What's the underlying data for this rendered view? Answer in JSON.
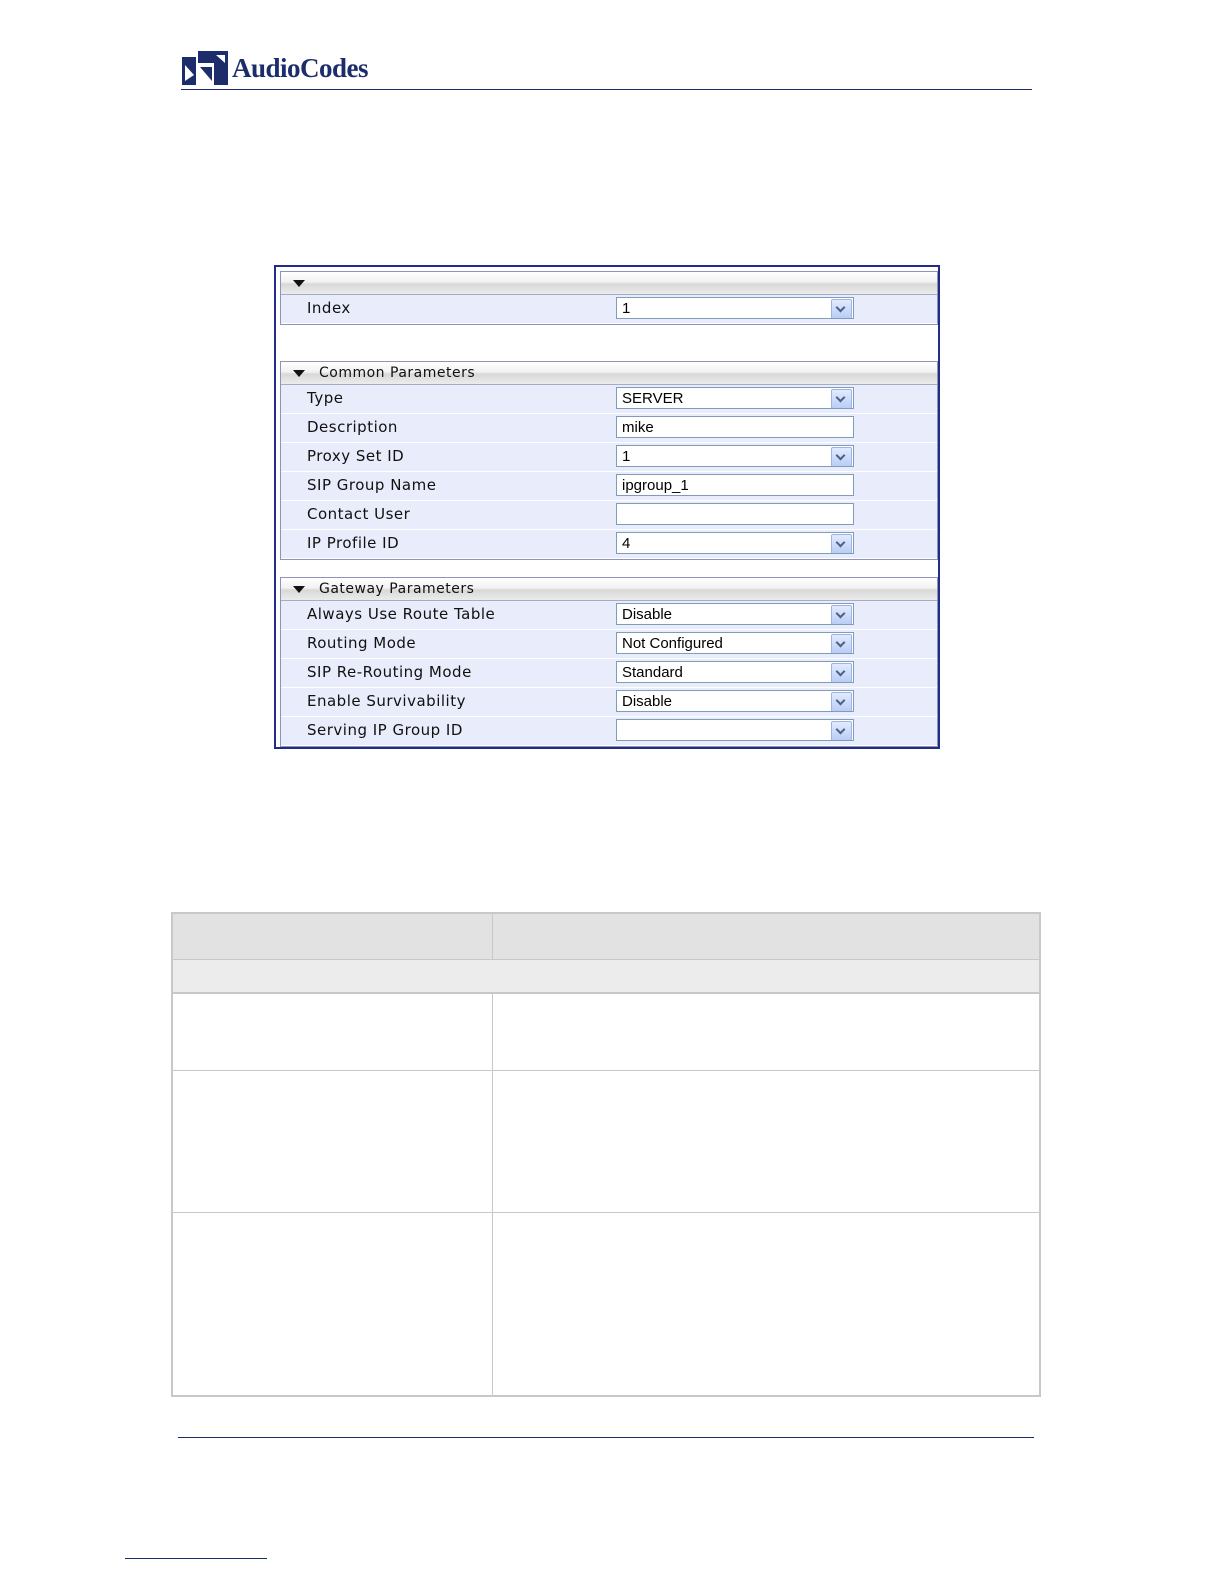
{
  "header": {
    "brand": "AudioCodes"
  },
  "panel": {
    "index_group": {
      "title": "",
      "rows": [
        {
          "label": "Index",
          "value": "1",
          "control": "select"
        }
      ]
    },
    "common_group": {
      "title": "Common Parameters",
      "rows": [
        {
          "label": "Type",
          "value": "SERVER",
          "control": "select"
        },
        {
          "label": "Description",
          "value": "mike",
          "control": "text"
        },
        {
          "label": "Proxy Set ID",
          "value": "1",
          "control": "select"
        },
        {
          "label": "SIP Group Name",
          "value": "ipgroup_1",
          "control": "text"
        },
        {
          "label": "Contact User",
          "value": "",
          "control": "text"
        },
        {
          "label": "IP Profile ID",
          "value": "4",
          "control": "select"
        }
      ]
    },
    "gateway_group": {
      "title": "Gateway Parameters",
      "rows": [
        {
          "label": "Always Use Route Table",
          "value": "Disable",
          "control": "select"
        },
        {
          "label": "Routing Mode",
          "value": "Not Configured",
          "control": "select"
        },
        {
          "label": "SIP Re-Routing Mode",
          "value": "Standard",
          "control": "select"
        },
        {
          "label": "Enable Survivability",
          "value": "Disable",
          "control": "select"
        },
        {
          "label": "Serving IP Group ID",
          "value": "",
          "control": "select"
        }
      ]
    }
  },
  "colors": {
    "brand": "#1d2d6b",
    "panel_border": "#222a8a",
    "group_background": "#e9ecfa",
    "table_header": "#e2e2e2",
    "table_border": "#c8c8c8"
  }
}
